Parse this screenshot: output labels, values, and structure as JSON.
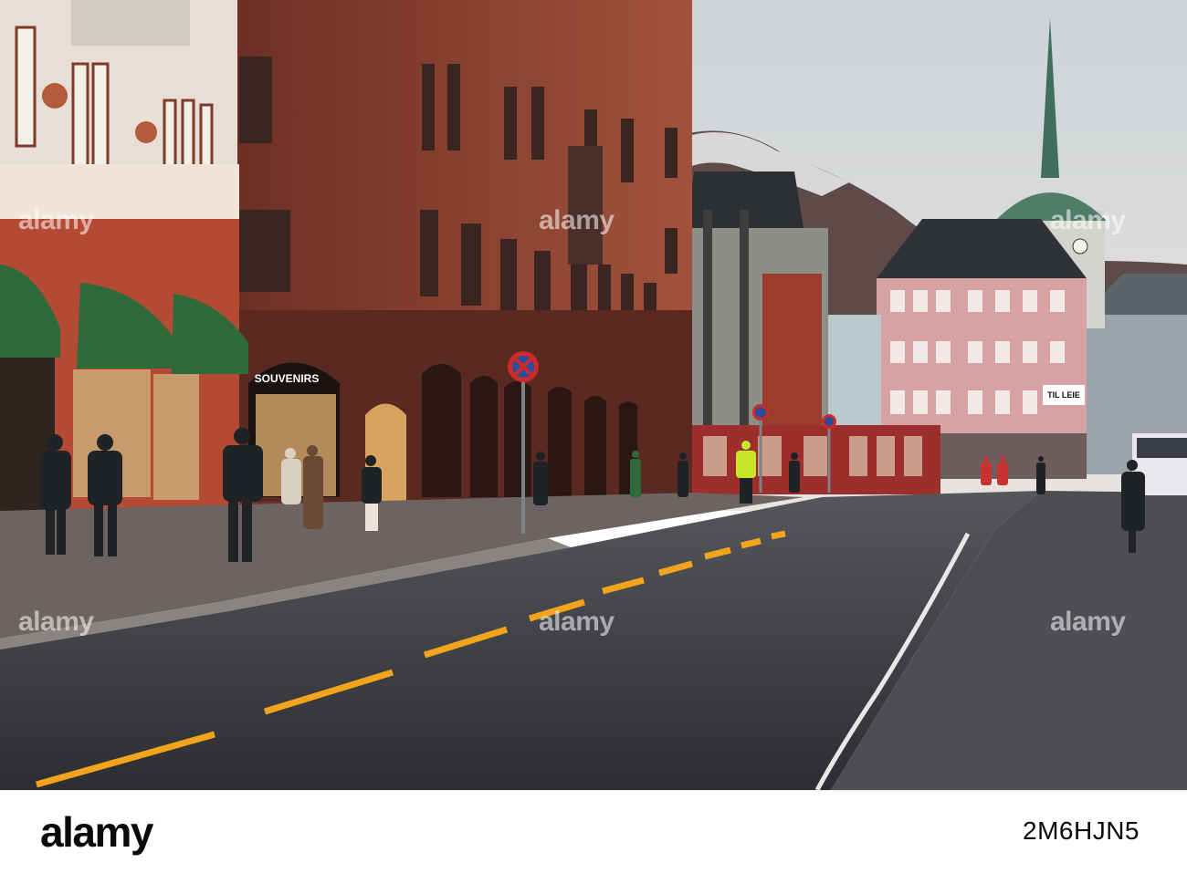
{
  "photo": {
    "signs": {
      "souvenirs": "SOUVENIRS",
      "til_leie": "TIL LEIE"
    }
  },
  "watermarks": [
    "alamy",
    "alamy",
    "alamy",
    "alamy",
    "alamy",
    "alamy"
  ],
  "footer": {
    "logo": "alamy",
    "stock_id": "2M6HJN5"
  },
  "colors": {
    "brick": "#8a3b2a",
    "awning_green": "#2f6b3a",
    "sky": "#dfe3e6",
    "road": "#3a3b3f",
    "lane_yellow": "#f2a41c"
  }
}
